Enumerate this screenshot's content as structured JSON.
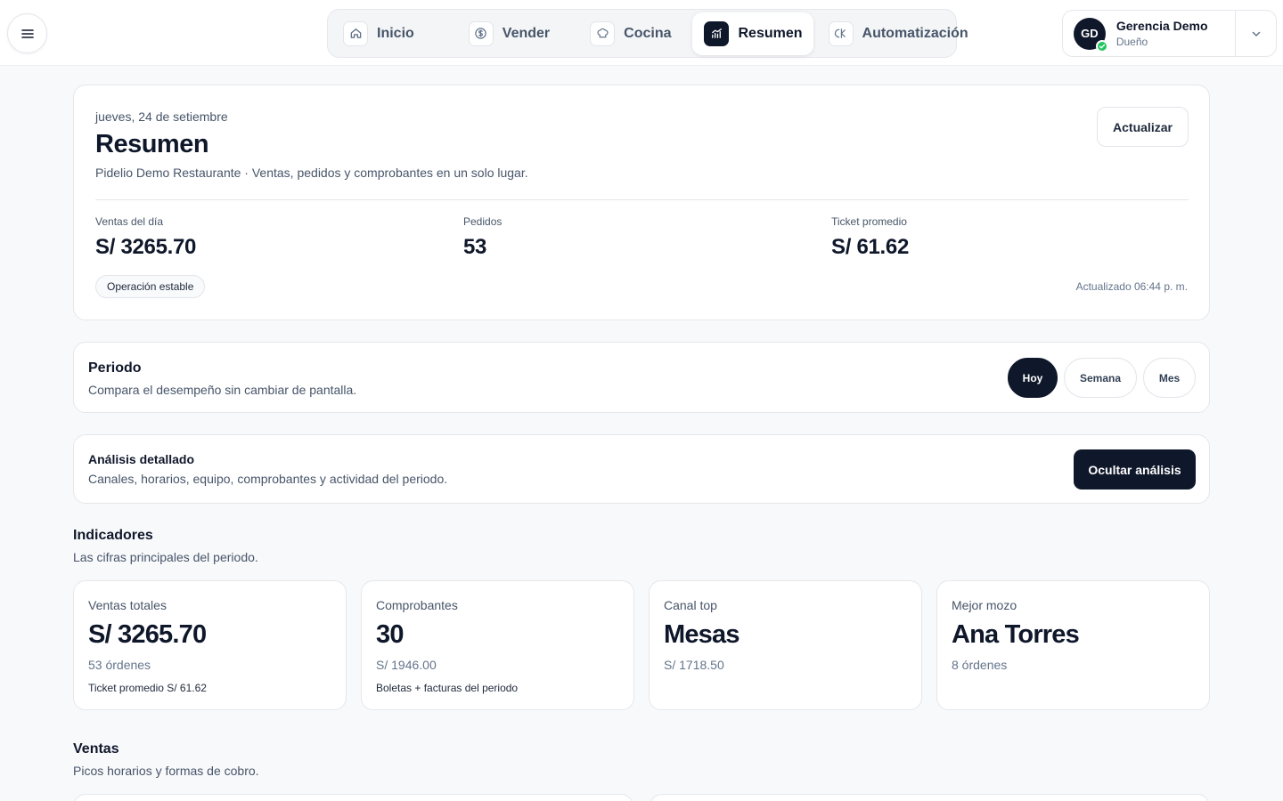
{
  "nav": {
    "items": [
      {
        "label": "Inicio",
        "icon": "home-icon"
      },
      {
        "label": "Vender",
        "icon": "dollar-icon"
      },
      {
        "label": "Cocina",
        "icon": "chef-hat-icon"
      },
      {
        "label": "Resumen",
        "icon": "chart-icon"
      },
      {
        "label": "Automatización",
        "icon": "automation-icon"
      }
    ],
    "active": "Resumen"
  },
  "user": {
    "initials": "GD",
    "name": "Gerencia Demo",
    "role": "Dueño"
  },
  "hero": {
    "date": "jueves, 24 de setiembre",
    "title": "Resumen",
    "subtitle": "Pidelio Demo Restaurante · Ventas, pedidos y comprobantes en un solo lugar.",
    "refresh_label": "Actualizar",
    "stats": [
      {
        "label": "Ventas del día",
        "value": "S/ 3265.70"
      },
      {
        "label": "Pedidos",
        "value": "53"
      },
      {
        "label": "Ticket promedio",
        "value": "S/ 61.62"
      }
    ],
    "status_pill": "Operación estable",
    "updated": "Actualizado 06:44 p. m."
  },
  "period": {
    "title": "Periodo",
    "subtitle": "Compara el desempeño sin cambiar de pantalla.",
    "options": [
      "Hoy",
      "Semana",
      "Mes"
    ],
    "selected": "Hoy"
  },
  "analysis": {
    "title": "Análisis detallado",
    "subtitle": "Canales, horarios, equipo, comprobantes y actividad del periodo.",
    "button_label": "Ocultar análisis"
  },
  "indicators": {
    "title": "Indicadores",
    "subtitle": "Las cifras principales del periodo.",
    "cards": [
      {
        "label": "Ventas totales",
        "value": "S/ 3265.70",
        "sub": "53 órdenes",
        "foot": "Ticket promedio S/ 61.62"
      },
      {
        "label": "Comprobantes",
        "value": "30",
        "sub": "S/ 1946.00",
        "foot": "Boletas + facturas del periodo"
      },
      {
        "label": "Canal top",
        "value": "Mesas",
        "sub": "S/ 1718.50",
        "foot": ""
      },
      {
        "label": "Mejor mozo",
        "value": "Ana Torres",
        "sub": "8 órdenes",
        "foot": ""
      }
    ]
  },
  "sales": {
    "title": "Ventas",
    "subtitle": "Picos horarios y formas de cobro."
  },
  "colors": {
    "primary": "#0f172a",
    "success": "#22c55e",
    "background": "#f8f9fb"
  }
}
